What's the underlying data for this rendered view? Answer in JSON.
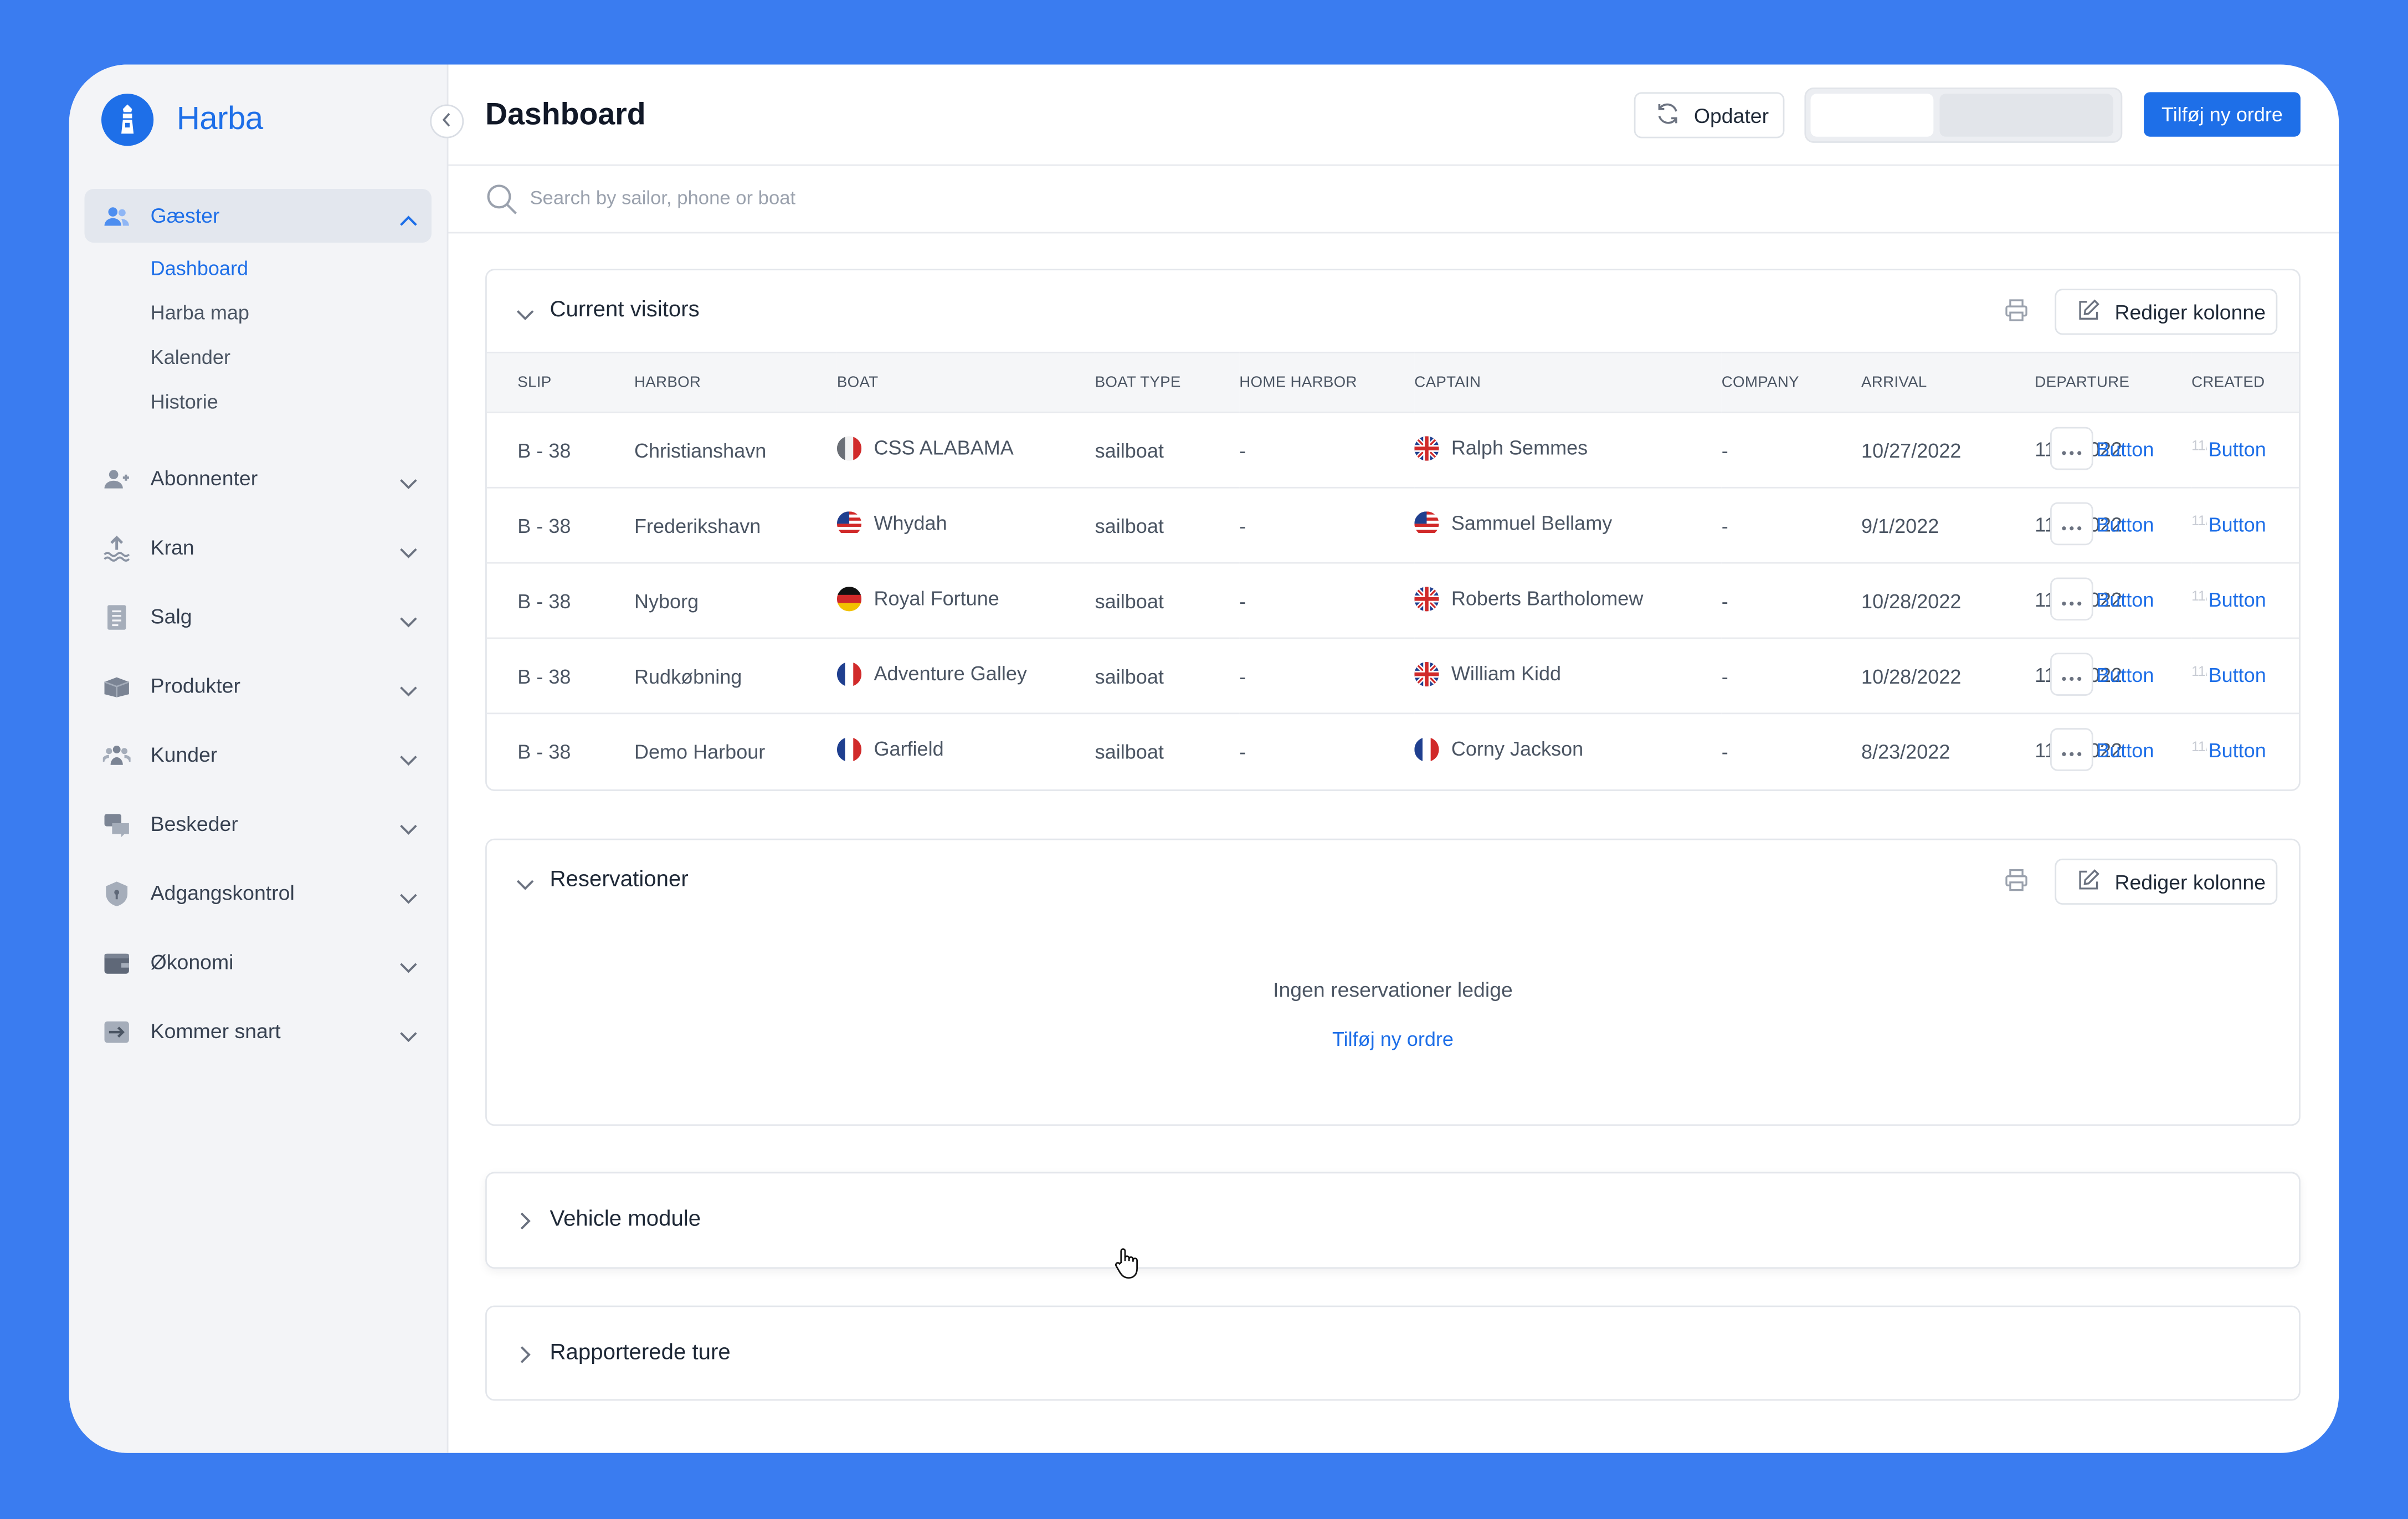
{
  "app": {
    "name": "Harba"
  },
  "sidebar": {
    "groups": [
      {
        "label": "Gæster",
        "icon": "users-icon",
        "expanded": true,
        "items": [
          "Dashboard",
          "Harba map",
          "Kalender",
          "Historie"
        ]
      },
      {
        "label": "Abonnenter",
        "icon": "subscribers-icon"
      },
      {
        "label": "Kran",
        "icon": "crane-icon"
      },
      {
        "label": "Salg",
        "icon": "receipt-icon"
      },
      {
        "label": "Produkter",
        "icon": "box-icon"
      },
      {
        "label": "Kunder",
        "icon": "customers-icon"
      },
      {
        "label": "Beskeder",
        "icon": "messages-icon"
      },
      {
        "label": "Adgangskontrol",
        "icon": "shield-icon"
      },
      {
        "label": "Økonomi",
        "icon": "wallet-icon"
      },
      {
        "label": "Kommer snart",
        "icon": "arrow-right-icon"
      }
    ],
    "active_item": "Dashboard"
  },
  "header": {
    "title": "Dashboard",
    "refresh_label": "Opdater",
    "add_order_label": "Tilføj ny ordre"
  },
  "search": {
    "placeholder": "Search by sailor, phone or boat",
    "value": ""
  },
  "current_visitors": {
    "title": "Current visitors",
    "edit_columns_label": "Rediger kolonne",
    "columns": [
      "SLIP",
      "HARBOR",
      "BOAT",
      "BOAT TYPE",
      "HOME HARBOR",
      "CAPTAIN",
      "COMPANY",
      "ARRIVAL",
      "DEPARTURE",
      "CREATED"
    ],
    "rows": [
      {
        "slip": "B - 38",
        "harbor": "Christianshavn",
        "boat": "CSS ALABAMA",
        "boat_flag": "italy",
        "boat_type": "sailboat",
        "home_harbor": "-",
        "captain": "Ralph Semmes",
        "captain_flag": "uk",
        "company": "-",
        "arrival": "10/27/2022",
        "departure": "11/1/2022",
        "departure_button": "Button",
        "created": "11/1/2022",
        "created_button": "Button"
      },
      {
        "slip": "B - 38",
        "harbor": "Frederikshavn",
        "boat": "Whydah",
        "boat_flag": "usa",
        "boat_type": "sailboat",
        "home_harbor": "-",
        "captain": "Sammuel Bellamy",
        "captain_flag": "usa",
        "company": "-",
        "arrival": "9/1/2022",
        "departure": "11/1/2022",
        "departure_button": "Button",
        "created": "11/1/2022",
        "created_button": "Button"
      },
      {
        "slip": "B - 38",
        "harbor": "Nyborg",
        "boat": "Royal Fortune",
        "boat_flag": "germany",
        "boat_type": "sailboat",
        "home_harbor": "-",
        "captain": "Roberts Bartholomew",
        "captain_flag": "uk",
        "company": "-",
        "arrival": "10/28/2022",
        "departure": "11/1/2022",
        "departure_button": "Button",
        "created": "11/1/2022",
        "created_button": "Button"
      },
      {
        "slip": "B - 38",
        "harbor": "Rudkøbning",
        "boat": "Adventure Galley",
        "boat_flag": "france",
        "boat_type": "sailboat",
        "home_harbor": "-",
        "captain": "William Kidd",
        "captain_flag": "uk",
        "company": "-",
        "arrival": "10/28/2022",
        "departure": "11/1/2022",
        "departure_button": "Button",
        "created": "11/1/2022",
        "created_button": "Button"
      },
      {
        "slip": "B - 38",
        "harbor": "Demo Harbour",
        "boat": "Garfield",
        "boat_flag": "france",
        "boat_type": "sailboat",
        "home_harbor": "-",
        "captain": "Corny Jackson",
        "captain_flag": "france",
        "company": "-",
        "arrival": "8/23/2022",
        "departure": "11/1/2022",
        "departure_button": "Button",
        "created": "11/1/2022",
        "created_button": "Button"
      }
    ]
  },
  "reservations": {
    "title": "Reservationer",
    "edit_columns_label": "Rediger kolonne",
    "empty_text": "Ingen reservationer ledige",
    "empty_link": "Tilføj ny ordre"
  },
  "vehicle_module": {
    "title": "Vehicle module"
  },
  "reported_trips": {
    "title": "Rapporterede ture"
  },
  "colors": {
    "accent": "#1e6fe8",
    "frame_background": "#3a7cf0",
    "sidebar_background": "#f3f4f7",
    "muted_text": "#4b5563"
  }
}
